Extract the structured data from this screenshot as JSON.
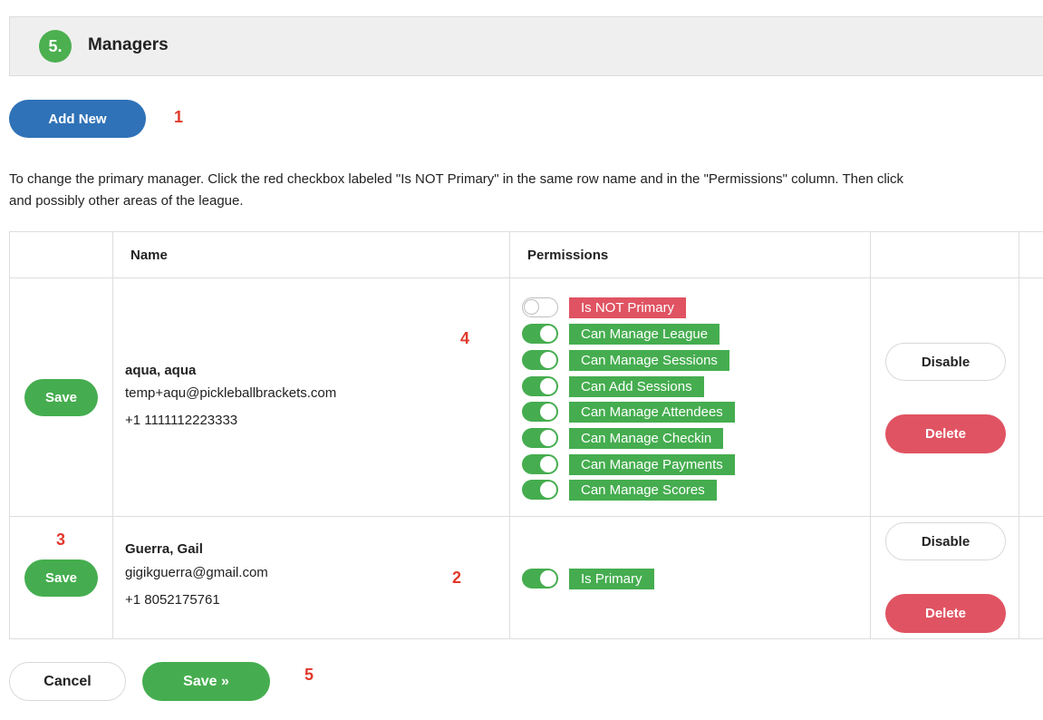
{
  "section": {
    "step": "5.",
    "title": "Managers"
  },
  "add_new_label": "Add New",
  "annotations": {
    "a1": "1",
    "a2": "2",
    "a3": "3",
    "a4": "4",
    "a5": "5"
  },
  "instructions": {
    "line1": "To change the primary manager. Click the red checkbox labeled \"Is NOT Primary\" in the same row name and in the \"Permissions\" column. Then click",
    "line2": "and possibly other areas of the league."
  },
  "table": {
    "headers": {
      "name": "Name",
      "permissions": "Permissions"
    },
    "rows": [
      {
        "save_label": "Save",
        "name": "aqua, aqua",
        "email": "temp+aqu@pickleballbrackets.com",
        "phone": "+1 1111112223333",
        "permissions": [
          {
            "label": "Is NOT Primary",
            "on": false
          },
          {
            "label": "Can Manage League",
            "on": true
          },
          {
            "label": "Can Manage Sessions",
            "on": true
          },
          {
            "label": "Can Add Sessions",
            "on": true
          },
          {
            "label": "Can Manage Attendees",
            "on": true
          },
          {
            "label": "Can Manage Checkin",
            "on": true
          },
          {
            "label": "Can Manage Payments",
            "on": true
          },
          {
            "label": "Can Manage Scores",
            "on": true
          }
        ],
        "disable_label": "Disable",
        "delete_label": "Delete"
      },
      {
        "save_label": "Save",
        "name": "Guerra, Gail",
        "email": "gigikguerra@gmail.com",
        "phone": "+1 8052175761",
        "permissions": [
          {
            "label": "Is Primary",
            "on": true
          }
        ],
        "disable_label": "Disable",
        "delete_label": "Delete"
      }
    ]
  },
  "footer": {
    "cancel_label": "Cancel",
    "save_label": "Save »"
  },
  "colors": {
    "green": "#45ad4f",
    "blue": "#2f72b7",
    "red": "#e05362"
  }
}
